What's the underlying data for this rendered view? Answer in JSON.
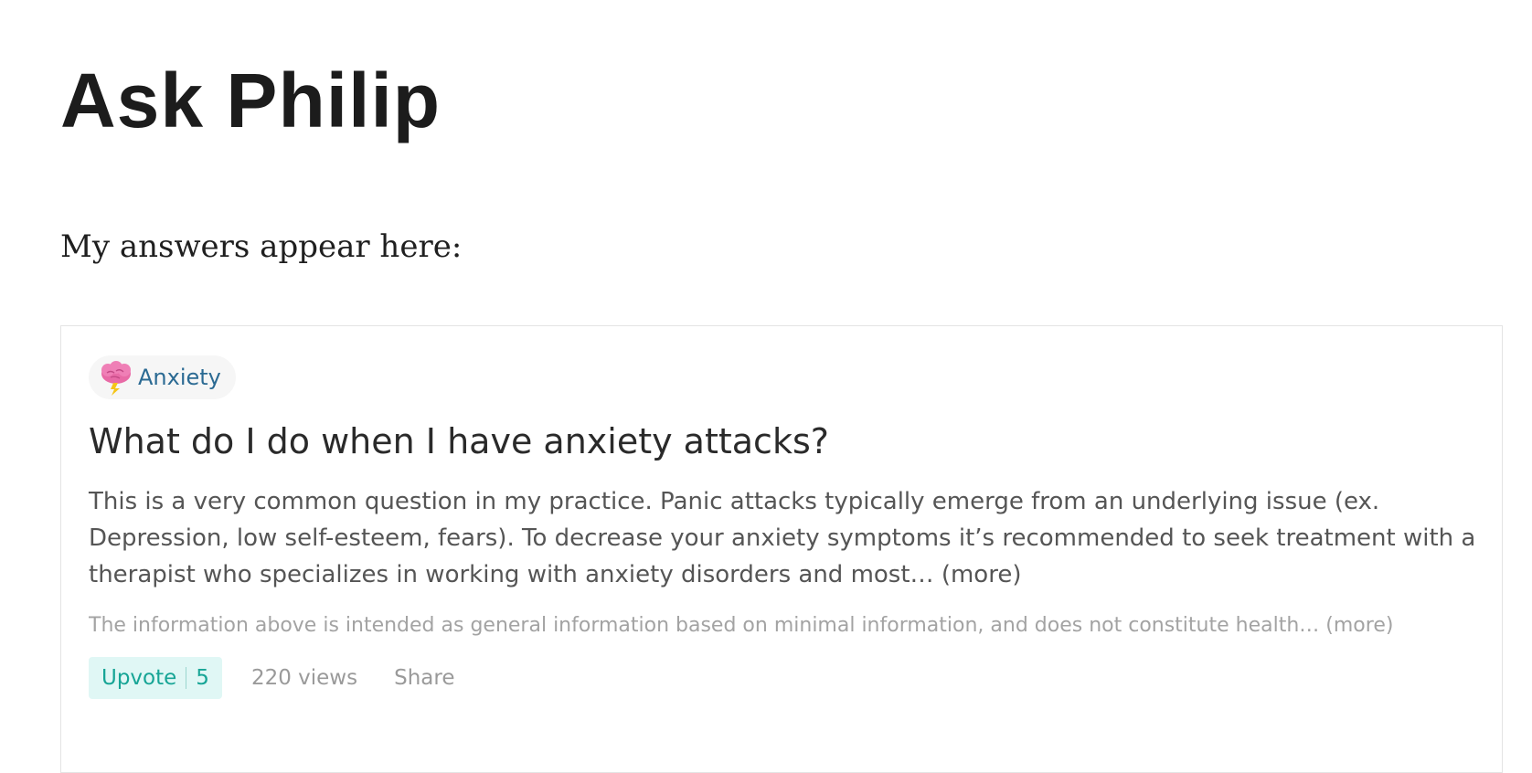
{
  "page": {
    "title": "Ask Philip",
    "intro": "My answers appear here:"
  },
  "answer_card": {
    "topic": {
      "label": "Anxiety",
      "icon": "brain-lightning-icon"
    },
    "question": "What do I do when I have anxiety attacks?",
    "body": "This is a very common question in my practice. Panic attacks typically emerge from an underlying issue (ex. Depression, low self-esteem, fears). To decrease your anxiety symptoms it’s recommended to seek treatment with a therapist who specializes in working with anxiety disorders and most…",
    "body_more": "(more)",
    "disclaimer": "The information above is intended as general information based on minimal information, and does not constitute health…",
    "disclaimer_more": "(more)",
    "upvote_label": "Upvote",
    "upvote_count": "5",
    "views": "220 views",
    "share_label": "Share"
  },
  "colors": {
    "topic_text": "#2b6a93",
    "upvote_bg": "#e0f7f5",
    "upvote_text": "#17a596",
    "muted_text": "#9a9a9a"
  }
}
